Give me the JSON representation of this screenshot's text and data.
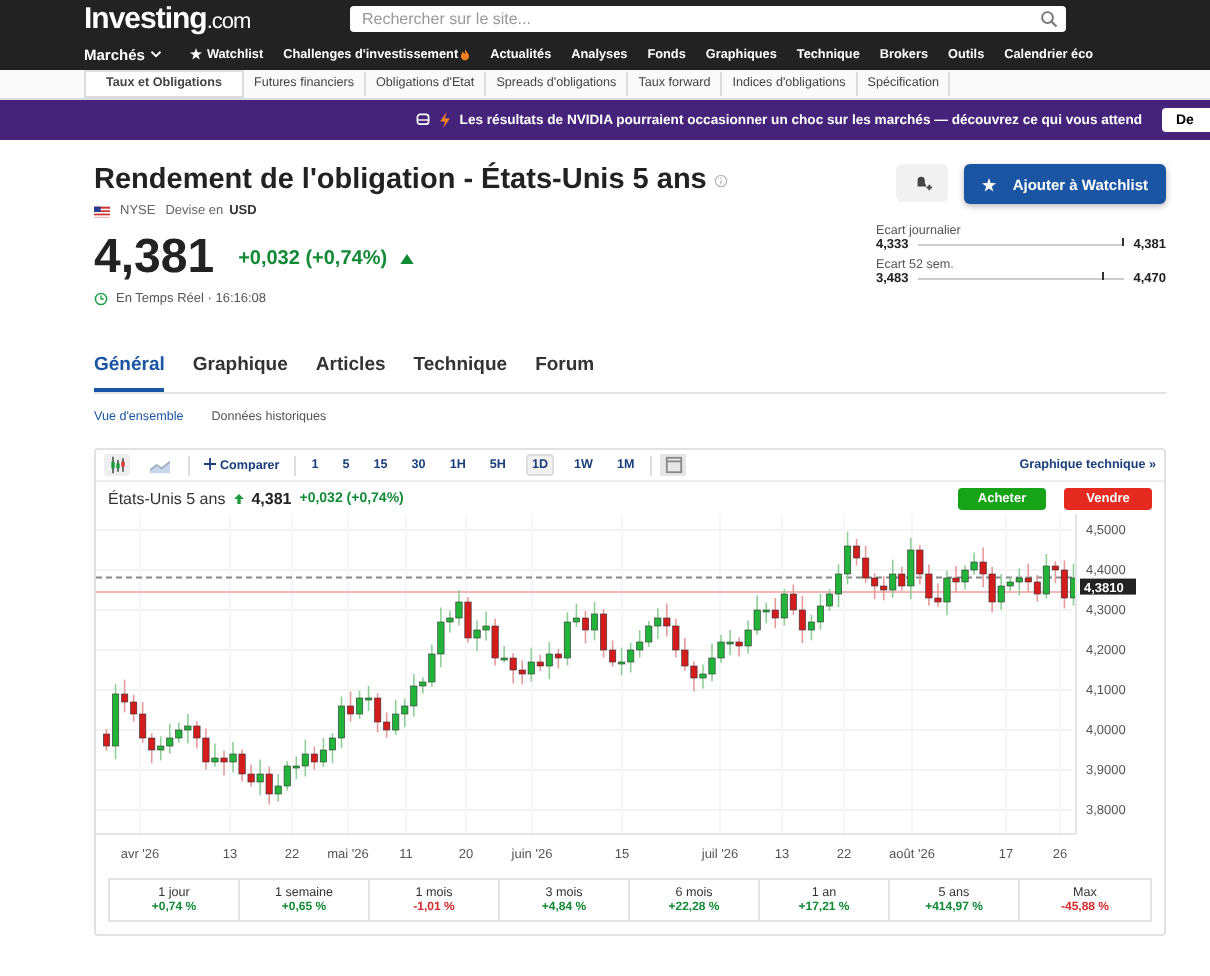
{
  "header": {
    "logo": "Investing",
    "logo_suffix": ".com",
    "search": {
      "placeholder": "Rechercher sur le site..."
    },
    "nav": [
      {
        "label": "Marchés",
        "kind": "dropdown"
      },
      {
        "label": "Watchlist",
        "kind": "star"
      },
      {
        "label": "Challenges d'investissement",
        "kind": "fire"
      },
      {
        "label": "Actualités",
        "kind": "plain"
      },
      {
        "label": "Analyses",
        "kind": "plain"
      },
      {
        "label": "Fonds",
        "kind": "plain"
      },
      {
        "label": "Graphiques",
        "kind": "plain"
      },
      {
        "label": "Technique",
        "kind": "plain"
      },
      {
        "label": "Brokers",
        "kind": "plain"
      },
      {
        "label": "Outils",
        "kind": "plain"
      },
      {
        "label": "Calendrier éco",
        "kind": "plain"
      }
    ]
  },
  "subnav": [
    {
      "label": "Taux et Obligations",
      "selected": true
    },
    {
      "label": "Futures financiers",
      "selected": false
    },
    {
      "label": "Obligations d'Etat",
      "selected": false
    },
    {
      "label": "Spreads d'obligations",
      "selected": false
    },
    {
      "label": "Taux forward",
      "selected": false
    },
    {
      "label": "Indices d'obligations",
      "selected": false
    },
    {
      "label": "Spécification",
      "selected": false
    }
  ],
  "banner": {
    "text": "Les résultats de NVIDIA pourraient occasionner un choc sur les marchés — découvrez ce qui vous attend",
    "button": "De"
  },
  "instrument": {
    "title": "Rendement de l'obligation - États-Unis 5 ans",
    "exchange": "NYSE",
    "currency_label": "Devise en",
    "currency": "USD",
    "price": "4,381",
    "change": "+0,032 (+0,74%)",
    "rising": true,
    "time": "En Temps Réel · 16:16:08",
    "watchlist_button": "Ajouter à Watchlist",
    "ranges": [
      {
        "label": "Ecart journalier",
        "low": "4,333",
        "high": "4,381",
        "level": 1.0
      },
      {
        "label": "Ecart 52 sem.",
        "low": "3,483",
        "high": "4,470",
        "level": 0.91
      }
    ]
  },
  "tabs": [
    {
      "label": "Général",
      "selected": true
    },
    {
      "label": "Graphique",
      "selected": false
    },
    {
      "label": "Articles",
      "selected": false
    },
    {
      "label": "Technique",
      "selected": false
    },
    {
      "label": "Forum",
      "selected": false
    }
  ],
  "subtabs": [
    {
      "label": "Vue d'ensemble",
      "selected": true
    },
    {
      "label": "Données historiques",
      "selected": false
    }
  ],
  "chart": {
    "compare": "Comparer",
    "intervals": [
      {
        "label": "1",
        "selected": false
      },
      {
        "label": "5",
        "selected": false
      },
      {
        "label": "15",
        "selected": false
      },
      {
        "label": "30",
        "selected": false
      },
      {
        "label": "1H",
        "selected": false
      },
      {
        "label": "5H",
        "selected": false
      },
      {
        "label": "1D",
        "selected": true
      },
      {
        "label": "1W",
        "selected": false
      },
      {
        "label": "1M",
        "selected": false
      }
    ],
    "technical_link": "Graphique technique »",
    "quote_name": "États-Unis 5 ans",
    "quote_price": "4,381",
    "quote_change": "+0,032 (+0,74%)",
    "buy": "Acheter",
    "sell": "Vendre",
    "y_labels": [
      "4,5000",
      "4,4000",
      "4,3000",
      "4,2000",
      "4,1000",
      "4,0000",
      "3,9000",
      "3,8000"
    ],
    "x_labels": [
      "avr '26",
      "13",
      "22",
      "mai '26",
      "11",
      "20",
      "juin '26",
      "15",
      "juil '26",
      "13",
      "22",
      "août '26",
      "17",
      "26"
    ],
    "price_tag": "4,3810"
  },
  "performance": [
    {
      "label": "1 jour",
      "value": "+0,74 %",
      "positive": true
    },
    {
      "label": "1 semaine",
      "value": "+0,65 %",
      "positive": true
    },
    {
      "label": "1 mois",
      "value": "-1,01 %",
      "positive": false
    },
    {
      "label": "3 mois",
      "value": "+4,84 %",
      "positive": true
    },
    {
      "label": "6 mois",
      "value": "+22,28 %",
      "positive": true
    },
    {
      "label": "1 an",
      "value": "+17,21 %",
      "positive": true
    },
    {
      "label": "5 ans",
      "value": "+414,97 %",
      "positive": true
    },
    {
      "label": "Max",
      "value": "-45,88 %",
      "positive": false
    }
  ]
}
